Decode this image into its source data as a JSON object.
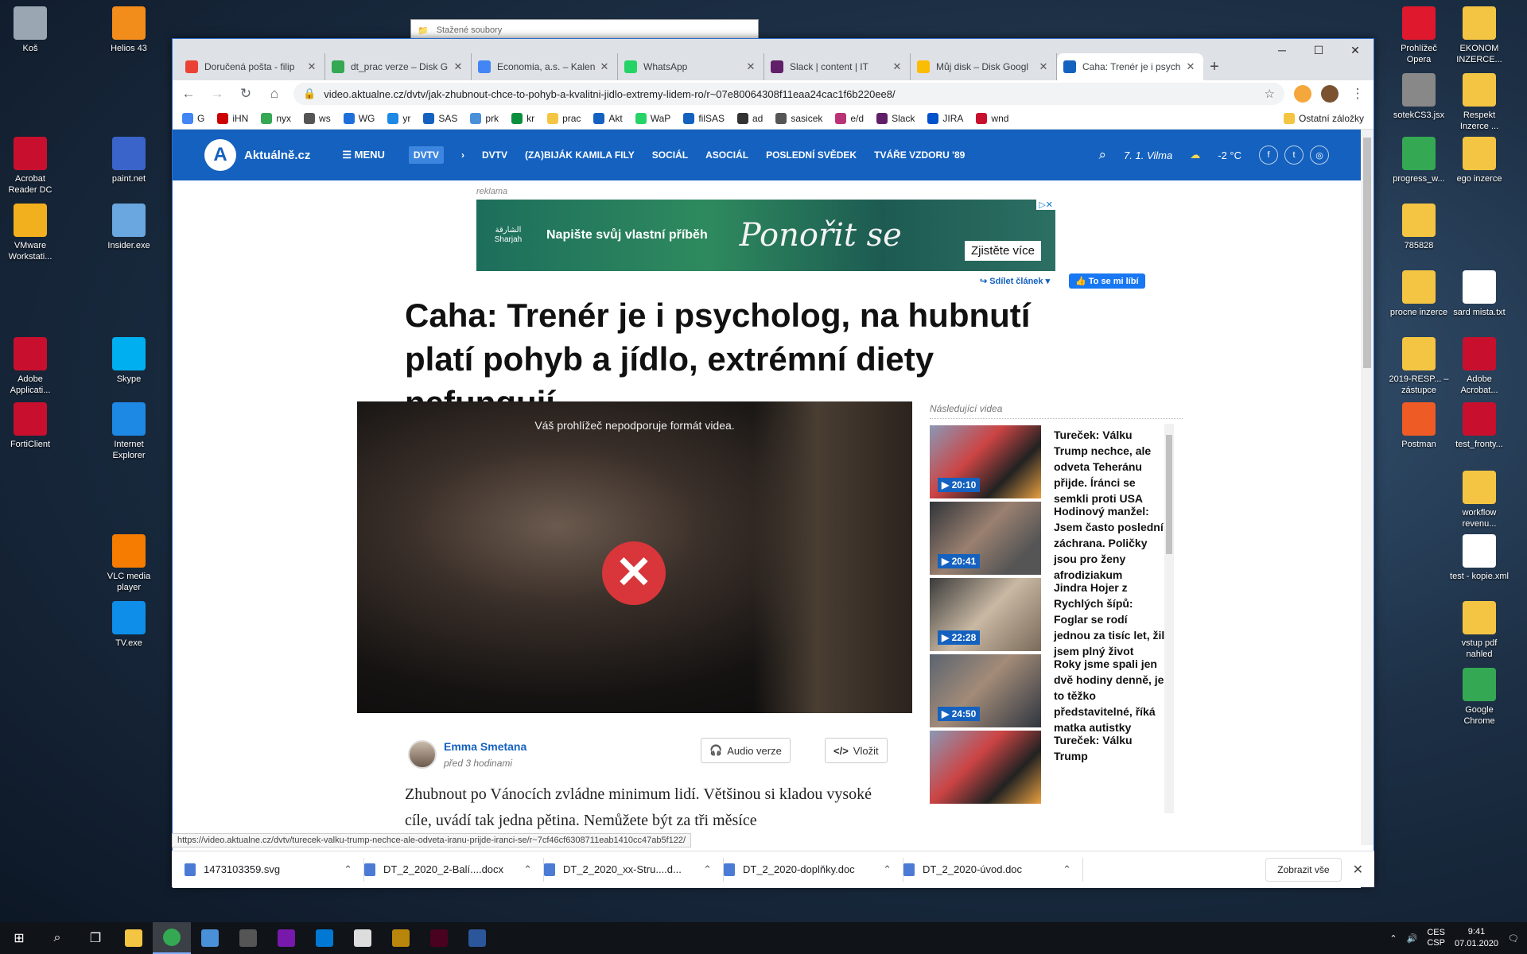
{
  "desktop": {
    "left_icons": [
      {
        "label": "Koš",
        "color": "#9aa7b3"
      },
      {
        "label": "Helios 43",
        "color": "#f28c1a"
      },
      {
        "label": "Acrobat Reader DC",
        "color": "#c8102e"
      },
      {
        "label": "paint.net",
        "color": "#3a64c9"
      },
      {
        "label": "VMware Workstati...",
        "color": "#f2b01e"
      },
      {
        "label": "Insider.exe",
        "color": "#6aa7e0"
      },
      {
        "label": "Adobe Applicati...",
        "color": "#c8102e"
      },
      {
        "label": "Skype",
        "color": "#00aff0"
      },
      {
        "label": "FortiClient",
        "color": "#c8102e"
      },
      {
        "label": "Internet Explorer",
        "color": "#1e88e5"
      },
      {
        "label": "VLC media player",
        "color": "#f57c00"
      },
      {
        "label": "TV.exe",
        "color": "#0e8ee9"
      }
    ],
    "right_icons": [
      {
        "label": "Prohlížeč Opera",
        "color": "#e0182d"
      },
      {
        "label": "EKONOM INZERCE...",
        "color": "#f4c542"
      },
      {
        "label": "sotekCS3.jsx",
        "color": "#888888"
      },
      {
        "label": "Respekt Inzerce ...",
        "color": "#f4c542"
      },
      {
        "label": "progress_w...",
        "color": "#34a853"
      },
      {
        "label": "ego inzerce",
        "color": "#f4c542"
      },
      {
        "label": "785828",
        "color": "#f4c542"
      },
      {
        "label": "procne inzerce",
        "color": "#f4c542"
      },
      {
        "label": "sard mista.txt",
        "color": "#ffffff"
      },
      {
        "label": "2019-RESP... – zástupce",
        "color": "#f4c542"
      },
      {
        "label": "Adobe Acrobat...",
        "color": "#c8102e"
      },
      {
        "label": "Postman",
        "color": "#ef5b25"
      },
      {
        "label": "test_fronty...",
        "color": "#c8102e"
      },
      {
        "label": "workflow revenu...",
        "color": "#f4c542"
      },
      {
        "label": "test - kopie.xml",
        "color": "#ffffff"
      },
      {
        "label": "vstup pdf nahled",
        "color": "#f4c542"
      },
      {
        "label": "Google Chrome",
        "color": "#34a853"
      }
    ],
    "explorer_title": "Stažené soubory"
  },
  "browser": {
    "tabs": [
      {
        "title": "Doručená pošta - filip",
        "color": "#ea4335"
      },
      {
        "title": "dt_prac verze – Disk G",
        "color": "#34a853"
      },
      {
        "title": "Economia, a.s. – Kalen",
        "color": "#4285f4"
      },
      {
        "title": "WhatsApp",
        "color": "#25d366"
      },
      {
        "title": "Slack | content | IT",
        "color": "#611f69"
      },
      {
        "title": "Můj disk – Disk Googl",
        "color": "#fbbc04"
      },
      {
        "title": "Caha: Trenér je i psych",
        "color": "#1461bf"
      }
    ],
    "new_tab": "+",
    "url": "video.aktualne.cz/dvtv/jak-zhubnout-chce-to-pohyb-a-kvalitni-jidlo-extremy-lidem-ro/r~07e80064308f11eaa24cac1f6b220ee8/",
    "bookmarks": [
      "G",
      "iHN",
      "nyx",
      "ws",
      "WG",
      "yr",
      "SAS",
      "prk",
      "kr",
      "prac",
      "Akt",
      "WaP",
      "filSAS",
      "ad",
      "sasicek",
      "e/d",
      "Slack",
      "JIRA",
      "wnd"
    ],
    "bookmarks_other": "Ostatní záložky"
  },
  "site": {
    "logo": "Aktuálně.cz",
    "menu": "MENU",
    "nav": [
      "DVTV",
      "DVTV",
      "(ZA)BIJÁK KAMILA FILY",
      "SOCIÁL",
      "ASOCIÁL",
      "POSLEDNÍ SVĚDEK",
      "TVÁŘE VZDORU '89"
    ],
    "date": "7. 1. Vilma",
    "temp": "-2 °C",
    "social": [
      "f",
      "t",
      "◎"
    ],
    "ad_label": "reklama",
    "ad": {
      "logo": "الشارقة Sharjah",
      "text": "Napište svůj vlastní příběh",
      "script": "Ponořit se",
      "button": "Zjistěte více"
    },
    "share": "Sdílet článek",
    "fb_like": "To se mi líbí",
    "headline": "Caha: Trenér je i psycholog, na hubnutí platí pohyb a jídlo, extrémní diety nefungují",
    "video_message": "Váš prohlížeč nepodporuje formát videa.",
    "author": "Emma Smetana",
    "published": "před 3 hodinami",
    "audio_button": "Audio verze",
    "embed_button": "Vložit",
    "perex": "Zhubnout po Vánocích zvládne minimum lidí. Většinou si kladou vysoké cíle, uvádí tak jedna pětina. Nemůžete být za tři měsíce",
    "sidebar_title": "Následující videa",
    "videos": [
      {
        "title": "Tureček: Válku Trump nechce, ale odveta Teheránu přijde. Íránci se semkli proti USA",
        "duration": "20:10"
      },
      {
        "title": "Hodinový manžel: Jsem často poslední záchrana. Poličky jsou pro ženy afrodiziakum",
        "duration": "20:41"
      },
      {
        "title": "Jindra Hojer z Rychlých šípů: Foglar se rodí jednou za tisíc let, žil jsem plný život",
        "duration": "22:28"
      },
      {
        "title": "Roky jsme spali jen dvě hodiny denně, je to těžko představitelné, říká matka autistky",
        "duration": "24:50"
      },
      {
        "title": "Tureček: Válku Trump",
        "duration": ""
      }
    ],
    "hover_url": "https://video.aktualne.cz/dvtv/turecek-valku-trump-nechce-ale-odveta-iranu-prijde-iranci-se/r~7cf46cf6308711eab1410cc47ab5f122/"
  },
  "downloads": {
    "files": [
      "1473103359.svg",
      "DT_2_2020_2-Balí....docx",
      "DT_2_2020_xx-Stru....d...",
      "DT_2_2020-doplňky.doc",
      "DT_2_2020-úvod.doc"
    ],
    "show_all": "Zobrazit vše"
  },
  "taskbar": {
    "lang": "CES\nCSP",
    "time": "9:41",
    "date": "07.01.2020"
  }
}
